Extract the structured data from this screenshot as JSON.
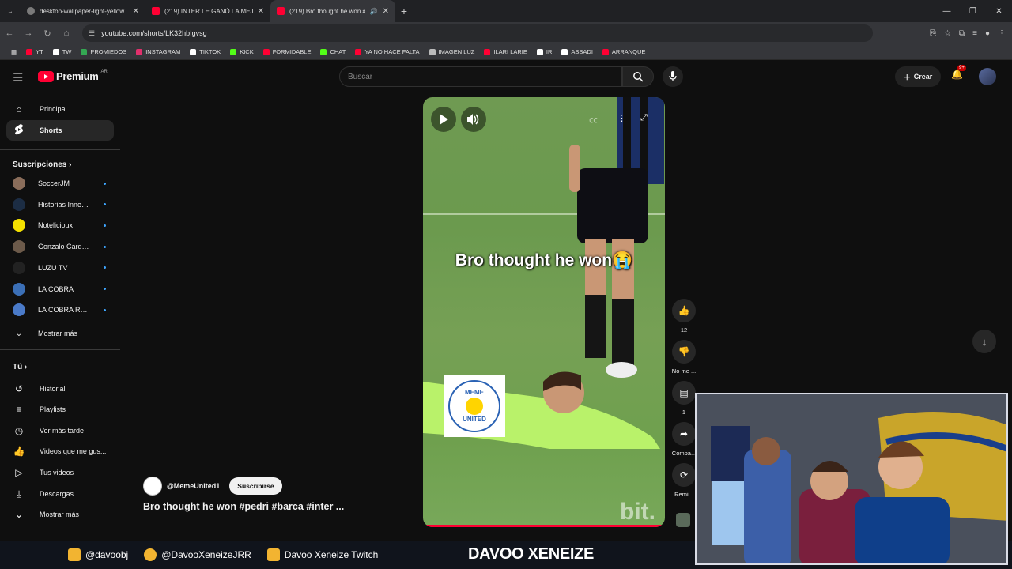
{
  "browser": {
    "tabs": [
      {
        "title": "desktop-wallpaper-light-yellow",
        "active": false
      },
      {
        "title": "(219) INTER LE GANÓ LA MEJO",
        "active": false
      },
      {
        "title": "(219) Bro thought he won #",
        "active": true
      }
    ],
    "url": "youtube.com/shorts/LK32hbIgvsg",
    "bookmarks": [
      {
        "label": "YT",
        "color": "#ff0033"
      },
      {
        "label": "TW",
        "color": "#ffffff"
      },
      {
        "label": "PROMIEDOS",
        "color": "#34a853"
      },
      {
        "label": "INSTAGRAM",
        "color": "#e1306c"
      },
      {
        "label": "TIKTOK",
        "color": "#ffffff"
      },
      {
        "label": "KICK",
        "color": "#53fc18"
      },
      {
        "label": "FORMIDABLE",
        "color": "#ff0033"
      },
      {
        "label": "CHAT",
        "color": "#53fc18"
      },
      {
        "label": "YA NO HACE FALTA",
        "color": "#ff0033"
      },
      {
        "label": "IMAGEN LUZ",
        "color": "#bbbbbb"
      },
      {
        "label": "ILARI LARIE",
        "color": "#ff0033"
      },
      {
        "label": "IR",
        "color": "#ffffff"
      },
      {
        "label": "ASSADI",
        "color": "#ffffff"
      },
      {
        "label": "ARRANQUE",
        "color": "#ff0033"
      }
    ]
  },
  "masthead": {
    "logo": "Premium",
    "country": "AR",
    "search_placeholder": "Buscar",
    "create_label": "Crear",
    "notif_badge": "9+"
  },
  "sidebar": {
    "main": [
      {
        "label": "Principal",
        "icon": "home-icon"
      },
      {
        "label": "Shorts",
        "icon": "shorts-icon"
      }
    ],
    "subs_heading": "Suscripciones",
    "subscriptions": [
      {
        "name": "SoccerJM",
        "color": "#8a6d5a"
      },
      {
        "name": "Historias Innece...",
        "color": "#1c2d44"
      },
      {
        "name": "Noteliciоux",
        "color": "#f4e100"
      },
      {
        "name": "Gonzalo Cardozo",
        "color": "#6c5a4a"
      },
      {
        "name": "LUZU TV",
        "color": "#222222"
      },
      {
        "name": "LA COBRA",
        "color": "#3b6fb6"
      },
      {
        "name": "LA COBRA Rand...",
        "color": "#4a7ac8"
      }
    ],
    "subs_more": "Mostrar más",
    "you_heading": "Tú",
    "you": [
      {
        "label": "Historial"
      },
      {
        "label": "Playlists"
      },
      {
        "label": "Ver más tarde"
      },
      {
        "label": "Videos que me gus..."
      },
      {
        "label": "Tus videos"
      },
      {
        "label": "Descargas"
      },
      {
        "label": "Mostrar más"
      }
    ]
  },
  "video": {
    "caption": "Bro thought he won😭",
    "stamp_top": "MEME",
    "stamp_bottom": "UNITED",
    "watermark": "bit.",
    "progress": 1.0
  },
  "actions": {
    "likes": "12",
    "dislike": "No me ...",
    "comments": "1",
    "share": "Compa...",
    "remix": "Remi..."
  },
  "channel": {
    "handle": "@MemeUnited1",
    "subscribe": "Suscribirse",
    "title": "Bro thought he won #pedri #barca #inter ..."
  },
  "overlay": {
    "instagram": "@davoobj",
    "twitter": "@DavooXeneizeJRR",
    "twitch": "Davoo Xeneize Twitch",
    "brand": "DAVOO XENEIZE"
  }
}
